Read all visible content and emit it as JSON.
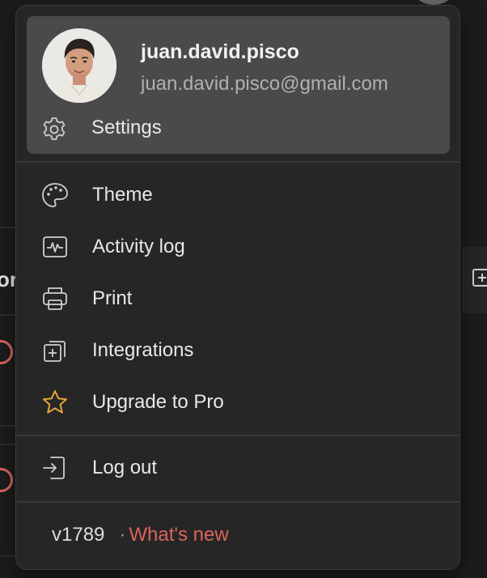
{
  "profile": {
    "username": "juan.david.pisco",
    "email": "juan.david.pisco@gmail.com"
  },
  "settings": {
    "label": "Settings",
    "icon": "gear-icon"
  },
  "menu_items": [
    {
      "label": "Theme",
      "icon": "palette-icon"
    },
    {
      "label": "Activity log",
      "icon": "activity-icon"
    },
    {
      "label": "Print",
      "icon": "printer-icon"
    },
    {
      "label": "Integrations",
      "icon": "integrations-icon"
    },
    {
      "label": "Upgrade to Pro",
      "icon": "star-icon"
    }
  ],
  "logout": {
    "label": "Log out",
    "icon": "logout-icon"
  },
  "footer": {
    "version": "v1789",
    "separator": "·",
    "whats_new": "What's new"
  },
  "colors": {
    "menu_bg": "#262626",
    "card_bg": "#4a4a4a",
    "accent_red": "#d9655a",
    "star_gold": "#e3a43a"
  }
}
